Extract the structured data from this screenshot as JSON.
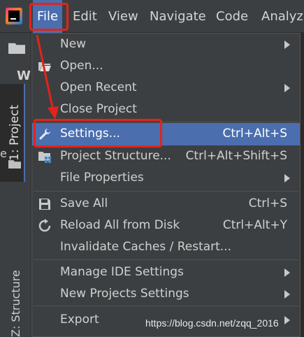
{
  "menubar": {
    "items": [
      "File",
      "Edit",
      "View",
      "Navigate",
      "Code",
      "Analyze"
    ]
  },
  "left_strip": {
    "wo_fragment": "W",
    "project_tab": "1: Project",
    "structure_tab": "Z: Structure",
    "left_fragment": "e"
  },
  "file_menu": {
    "new": {
      "label": "New"
    },
    "open": {
      "label": "Open..."
    },
    "open_recent": {
      "label": "Open Recent"
    },
    "close_project": {
      "label": "Close Project"
    },
    "settings": {
      "label": "Settings...",
      "shortcut": "Ctrl+Alt+S"
    },
    "project_structure": {
      "label": "Project Structure...",
      "shortcut": "Ctrl+Alt+Shift+S"
    },
    "file_properties": {
      "label": "File Properties"
    },
    "save_all": {
      "label": "Save All",
      "shortcut": "Ctrl+S"
    },
    "reload": {
      "label": "Reload All from Disk",
      "shortcut": "Ctrl+Alt+Y"
    },
    "invalidate": {
      "label": "Invalidate Caches / Restart..."
    },
    "manage_ide": {
      "label": "Manage IDE Settings"
    },
    "new_projects_settings": {
      "label": "New Projects Settings"
    },
    "export": {
      "label": "Export"
    }
  },
  "watermark": "https://blog.csdn.net/zqq_2016",
  "colors": {
    "highlight": "#4b6eaf",
    "annotation_red": "#e3241b",
    "menu_bg": "#3c3f41"
  }
}
